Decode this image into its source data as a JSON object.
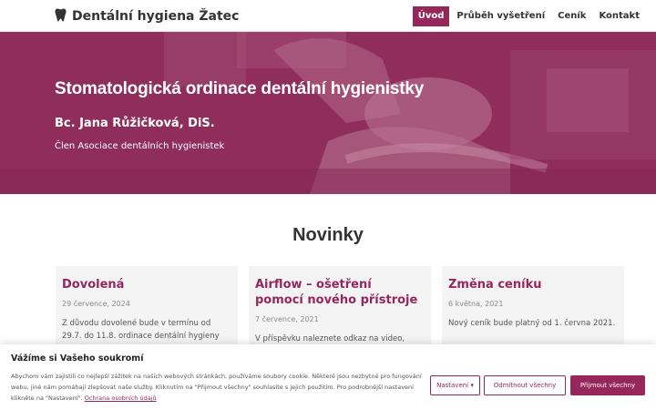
{
  "header": {
    "site_title": "Dentální hygiena Žatec",
    "icon": "tooth-icon",
    "nav": [
      {
        "label": "Úvod",
        "active": true
      },
      {
        "label": "Průběh vyšetření",
        "active": false
      },
      {
        "label": "Ceník",
        "active": false
      },
      {
        "label": "Kontakt",
        "active": false
      }
    ]
  },
  "hero": {
    "title": "Stomatologická ordinace dentální hygienistky",
    "name": "Bc. Jana Růžičková, DiS.",
    "subtitle": "Člen Asociace dentálních hygienistek"
  },
  "news": {
    "title": "Novinky",
    "items": [
      {
        "title": "Dovolená",
        "date": "29 července, 2024",
        "text": "Z důvodu dovolené bude v termínu od 29.7. do 11.8. ordinace dentální hygieny uzavřena."
      },
      {
        "title": "Airflow – ošetření pomocí nového přístroje",
        "date": "7 července, 2021",
        "text": "V příspěvku naleznete odkaz na video, které porovnává tradiční metody čištění zubů s Airflow."
      },
      {
        "title": "Změna ceníku",
        "date": "6 května, 2021",
        "text": "Nový ceník bude platný od 1. června 2021."
      }
    ]
  },
  "cookie": {
    "title": "Vážíme si Vašeho soukromí",
    "text": "Abychom vám zajistili co nejlepší zážitek na našich webových stránkách, používáme soubory cookie. Některé jsou nezbytné pro fungování webu, jiné nám pomáhají zlepšovat naše služby. Kliknutím na \"Přijmout všechny\" souhlasíte s jejich použitím. Pro podrobnější nastavení klikněte na \"Nastavení\".",
    "policy_link": "Ochrana osobních údajů",
    "buttons": {
      "settings": "Nastavení",
      "reject": "Odmítnout všechny",
      "accept": "Přijmout všechny"
    }
  },
  "colors": {
    "accent": "#96275a",
    "hero_overlay": "#962e5e",
    "card_bg": "#f4f4f4"
  }
}
